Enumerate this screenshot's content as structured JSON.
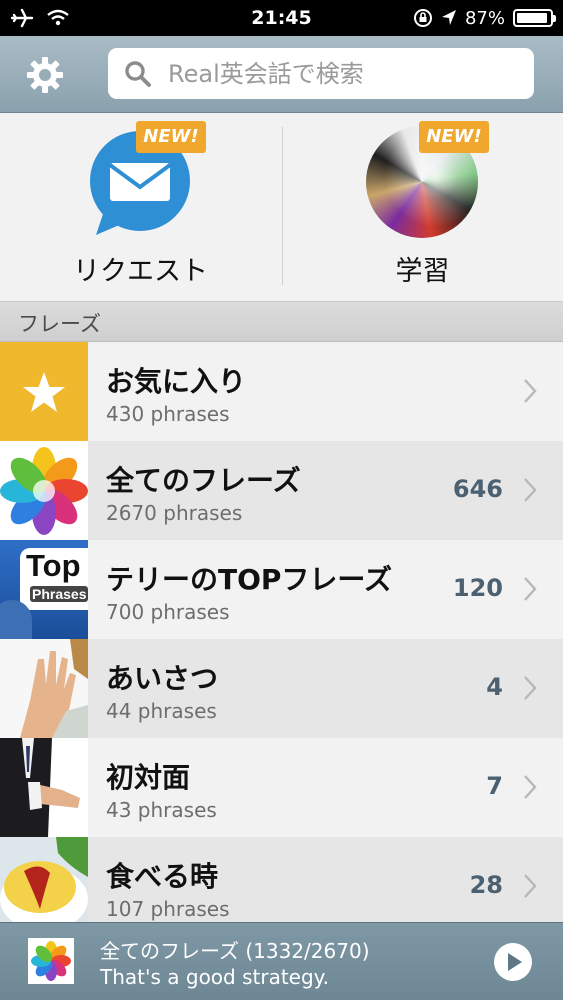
{
  "status_bar": {
    "time": "21:45",
    "battery_percent": "87%"
  },
  "header": {
    "search_placeholder": "Real英会話で検索"
  },
  "tiles": [
    {
      "label": "リクエスト",
      "badge": "NEW!"
    },
    {
      "label": "学習",
      "badge": "NEW!"
    }
  ],
  "section_title": "フレーズ",
  "list": [
    {
      "title": "お気に入り",
      "subtitle": "430 phrases",
      "count": ""
    },
    {
      "title": "全てのフレーズ",
      "subtitle": "2670 phrases",
      "count": "646"
    },
    {
      "title": "テリーのTOPフレーズ",
      "subtitle": "700 phrases",
      "count": "120",
      "thumb_text_1": "Top",
      "thumb_text_2": "Phrases"
    },
    {
      "title": "あいさつ",
      "subtitle": "44 phrases",
      "count": "4"
    },
    {
      "title": "初対面",
      "subtitle": "43 phrases",
      "count": "7"
    },
    {
      "title": "食べる時",
      "subtitle": "107 phrases",
      "count": "28"
    }
  ],
  "player": {
    "title": "全てのフレーズ (1332/2670)",
    "subtitle": "That's a good strategy."
  },
  "colors": {
    "accent_badge": "#f0a72d",
    "header": "#9fb3bd",
    "count_text": "#4b6172",
    "favorite_tile": "#f0b82d"
  }
}
